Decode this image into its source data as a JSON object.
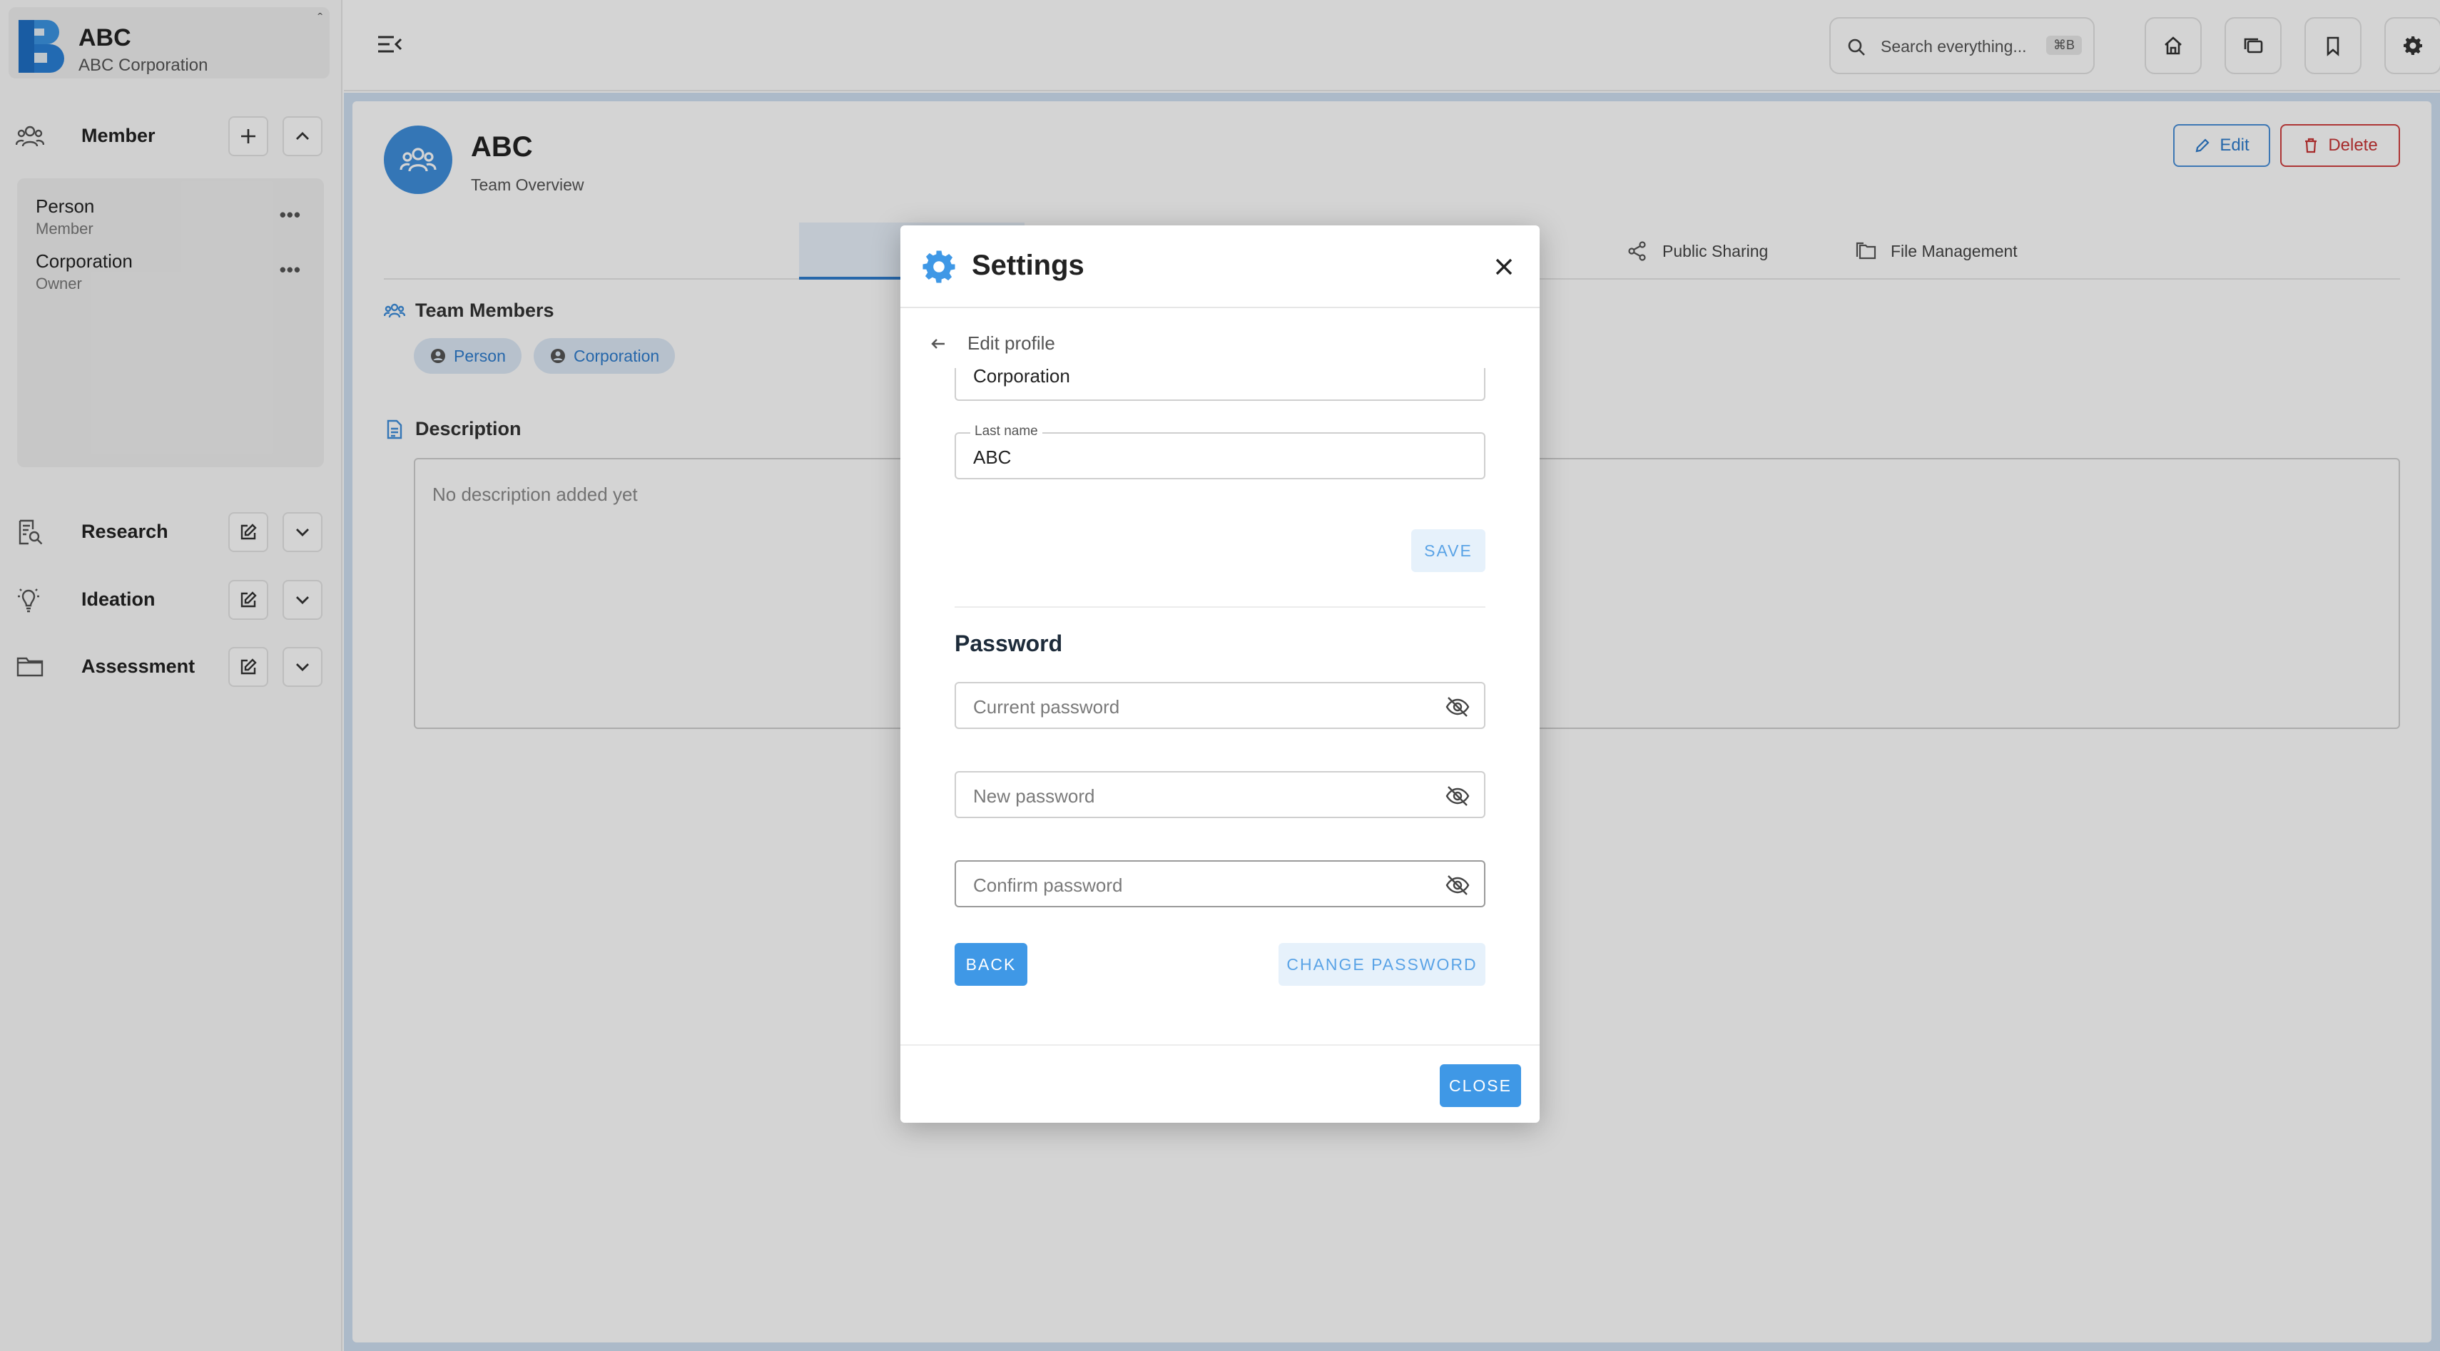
{
  "app": {
    "brand_title": "ABC",
    "brand_subtitle": "ABC Corporation",
    "collapse_glyph": "ˆ"
  },
  "sidebar": {
    "member_section": {
      "label": "Member",
      "icon": "team-icon"
    },
    "members": [
      {
        "name": "Person",
        "role": "Member"
      },
      {
        "name": "Corporation",
        "role": "Owner"
      }
    ],
    "more_glyph": "•••",
    "sections": [
      {
        "label": "Research",
        "icon": "research-icon"
      },
      {
        "label": "Ideation",
        "icon": "lightbulb-icon"
      },
      {
        "label": "Assessment",
        "icon": "folder-icon"
      }
    ]
  },
  "topbar": {
    "search_placeholder": "Search everything...",
    "search_shortcut": "⌘B"
  },
  "team": {
    "title": "ABC",
    "subtitle": "Team Overview",
    "edit_label": "Edit",
    "delete_label": "Delete",
    "tabs": [
      {
        "label": "Public Sharing",
        "icon": "share-icon"
      },
      {
        "label": "File Management",
        "icon": "files-icon"
      }
    ],
    "members_heading": "Team Members",
    "member_chips": [
      "Person",
      "Corporation"
    ],
    "description_heading": "Description",
    "description_placeholder": "No description added yet"
  },
  "dialog": {
    "title": "Settings",
    "subnav_label": "Edit profile",
    "first_name_partial": "Corporation",
    "last_name_label": "Last name",
    "last_name_value": "ABC",
    "save_label": "SAVE",
    "password_heading": "Password",
    "current_password_placeholder": "Current password",
    "new_password_placeholder": "New password",
    "confirm_password_placeholder": "Confirm password",
    "back_label": "BACK",
    "change_password_label": "CHANGE PASSWORD",
    "close_label": "CLOSE"
  },
  "colors": {
    "accent": "#3f98e6",
    "danger": "#c83434",
    "brand_blue": "#2d7dd2"
  }
}
